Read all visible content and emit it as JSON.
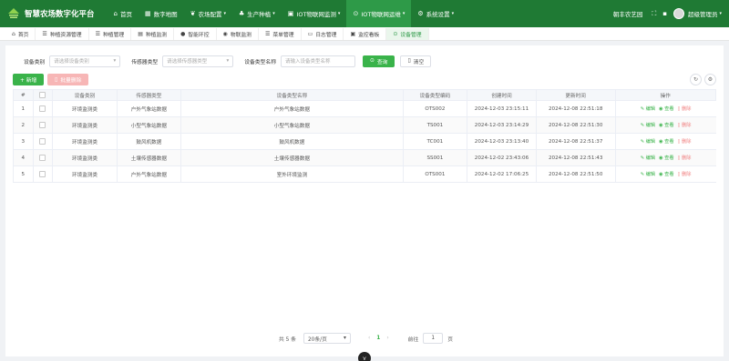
{
  "app": {
    "title": "智慧农场数字化平台",
    "brand_color": "#1f7a34",
    "accent": "#3ab34a"
  },
  "nav": [
    {
      "label": "首页",
      "icon": "home-icon",
      "glyph": "⌂",
      "caret": false,
      "active": false
    },
    {
      "label": "数字地图",
      "icon": "map-icon",
      "glyph": "▦",
      "caret": false,
      "active": false
    },
    {
      "label": "农场配置",
      "icon": "leaf-icon",
      "glyph": "❦",
      "caret": true,
      "active": false
    },
    {
      "label": "生产种植",
      "icon": "sprout-icon",
      "glyph": "♣",
      "caret": true,
      "active": false
    },
    {
      "label": "IOT物联网监测",
      "icon": "monitor-icon",
      "glyph": "▣",
      "caret": true,
      "active": false
    },
    {
      "label": "IOT物联网运维",
      "icon": "settings-icon",
      "glyph": "⊙",
      "caret": true,
      "active": true
    },
    {
      "label": "系统设置",
      "icon": "gear-icon",
      "glyph": "⚙",
      "caret": true,
      "active": false
    }
  ],
  "header_right": {
    "farm": "朝丰农艺园",
    "username": "超级管理员"
  },
  "tabs": [
    {
      "label": "首页",
      "icon": "home-icon",
      "glyph": "⌂",
      "active": false
    },
    {
      "label": "种植资源管理",
      "icon": "list-icon",
      "glyph": "☰",
      "active": false
    },
    {
      "label": "种植管理",
      "icon": "list-icon",
      "glyph": "☰",
      "active": false
    },
    {
      "label": "种植监测",
      "icon": "chart-icon",
      "glyph": "▤",
      "active": false
    },
    {
      "label": "智能环控",
      "icon": "dot-icon",
      "glyph": "●",
      "active": false
    },
    {
      "label": "物联监测",
      "icon": "camera-icon",
      "glyph": "◉",
      "active": false
    },
    {
      "label": "菜单管理",
      "icon": "menu-icon",
      "glyph": "☰",
      "active": false
    },
    {
      "label": "日志管理",
      "icon": "doc-icon",
      "glyph": "▭",
      "active": false
    },
    {
      "label": "监控看板",
      "icon": "monitor-icon",
      "glyph": "▣",
      "active": false
    },
    {
      "label": "设备管理",
      "icon": "device-icon",
      "glyph": "⊙",
      "active": true
    }
  ],
  "filters": {
    "device_category": {
      "label": "设备类别",
      "placeholder": "请选择设备类别"
    },
    "sensor_type": {
      "label": "传感器类型",
      "placeholder": "请选择传感器类型"
    },
    "type_name": {
      "label": "设备类型名称",
      "placeholder": "请输入设备类型名称"
    },
    "query_label": "查询",
    "reset_label": "清空"
  },
  "toolbar": {
    "add_label": "+ 新增",
    "batch_delete_label": "批量删除"
  },
  "table": {
    "headers": [
      "#",
      "",
      "设备类别",
      "传感器类型",
      "设备类型名称",
      "设备类型编码",
      "创建时间",
      "更新时间",
      "操作"
    ],
    "rows": [
      {
        "index": "1",
        "category": "环境监测类",
        "sensor": "户外气象站数据",
        "name": "户外气象站数据",
        "code": "OTS002",
        "created": "2024-12-03 23:15:11",
        "updated": "2024-12-08 22:51:18"
      },
      {
        "index": "2",
        "category": "环境监测类",
        "sensor": "小型气象站数据",
        "name": "小型气象站数据",
        "code": "TS001",
        "created": "2024-12-03 23:14:29",
        "updated": "2024-12-08 22:51:30"
      },
      {
        "index": "3",
        "category": "环境监测类",
        "sensor": "鼓风机数据",
        "name": "鼓风机数据",
        "code": "TC001",
        "created": "2024-12-03 23:13:40",
        "updated": "2024-12-08 22:51:37"
      },
      {
        "index": "4",
        "category": "环境监测类",
        "sensor": "土壤传感器数据",
        "name": "土壤传感器数据",
        "code": "SS001",
        "created": "2024-12-02 23:43:06",
        "updated": "2024-12-08 22:51:43"
      },
      {
        "index": "5",
        "category": "环境监测类",
        "sensor": "户外气象站数据",
        "name": "室外环境监测",
        "code": "OTS001",
        "created": "2024-12-02 17:06:25",
        "updated": "2024-12-08 22:51:50"
      }
    ],
    "actions": {
      "edit": "编辑",
      "view": "查看",
      "delete": "删除"
    }
  },
  "pagination": {
    "total": "共 5 条",
    "page_size": "20条/页",
    "current_page": "1",
    "goto_label": "前往",
    "goto_value": "1",
    "page_unit": "页"
  }
}
